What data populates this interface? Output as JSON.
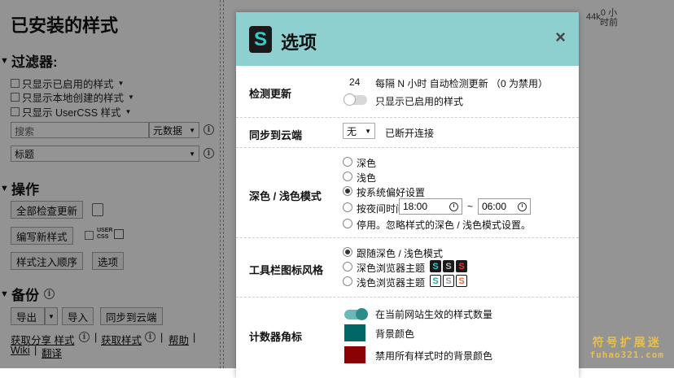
{
  "manage": {
    "page_title": "已安装的样式",
    "filters": {
      "heading": "过滤器:",
      "only_enabled": "只显示已启用的样式",
      "only_local": "只显示本地创建的样式",
      "only_usercss": "只显示 UserCSS 样式",
      "search_placeholder": "搜索",
      "search_scope": "元数据",
      "sort_value": "标题"
    },
    "actions": {
      "heading": "操作",
      "check_all_updates": "全部检查更新",
      "write_new_style": "编写新样式",
      "usercss_label": "USER CSS",
      "injection_order": "样式注入顺序",
      "options": "选项"
    },
    "backup": {
      "heading": "备份",
      "export": "导出",
      "import": "导入",
      "sync_cloud": "同步到云端"
    },
    "links": {
      "get_share": "获取分享 样式",
      "get_styles": "获取样式",
      "help": "帮助",
      "wiki": "Wiki",
      "translate": "翻译",
      "separator": "|"
    },
    "background_list": {
      "size": "44k",
      "age_line1": "0 小",
      "age_line2": "时前"
    }
  },
  "dialog": {
    "logo_letter": "S",
    "title": "选项",
    "close": "×",
    "update_check": {
      "label": "检测更新",
      "hours_value": "24",
      "hours_text": "每隔 N 小时 自动检测更新 （0 为禁用）",
      "only_enabled": "只显示已启用的样式",
      "only_enabled_on": false
    },
    "sync": {
      "label": "同步到云端",
      "provider": "无",
      "status": "已断开连接"
    },
    "dark_mode": {
      "label": "深色 / 浅色模式",
      "options": [
        "深色",
        "浅色",
        "按系统偏好设置",
        "按夜间时间",
        "停用。忽略样式的深色 / 浅色模式设置。"
      ],
      "selected_index": 2,
      "time_start": "18:00",
      "time_sep": "~",
      "time_end": "06:00"
    },
    "toolbar_icon": {
      "label": "工具栏图标风格",
      "options": [
        "跟随深色 / 浅色模式",
        "深色浏览器主题",
        "浅色浏览器主题"
      ],
      "selected_index": 0,
      "icon_letter": "S"
    },
    "badge": {
      "label": "计数器角标",
      "count_text": "在当前网站生效的样式数量",
      "count_on": true,
      "bg_label": "背景颜色",
      "disabled_bg_label": "禁用所有样式时的背景颜色"
    }
  },
  "colors": {
    "header_bg": "#8ed0d0",
    "accent_teal": "#006666",
    "disabled_red": "#8b0000",
    "toggle_on": "#2c8c8c"
  },
  "watermark": {
    "cn": "符号扩展迷",
    "en": "fuhao321.com"
  }
}
